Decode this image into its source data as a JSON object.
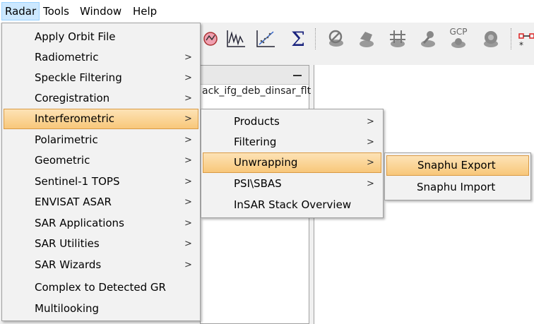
{
  "menubar": {
    "items": [
      "Radar",
      "Tools",
      "Window",
      "Help"
    ]
  },
  "toolbar": {
    "icons": [
      "graph-icon",
      "waveform-icon",
      "scatter-plot-icon",
      "sigma-icon",
      "no-orbit-icon",
      "coregistration-icon",
      "grid-icon",
      "pin-icon",
      "gcp-icon",
      "camera-icon",
      "network-icon"
    ],
    "sigma": "Σ",
    "gcp_label": "GCP"
  },
  "product_panel": {
    "item_text": "ack_ifg_deb_dinsar_flt"
  },
  "radar_menu": {
    "items": [
      {
        "label": "Apply Orbit File",
        "arrow": ""
      },
      {
        "label": "Radiometric",
        "arrow": ">"
      },
      {
        "label": "Speckle Filtering",
        "arrow": ">"
      },
      {
        "label": "Coregistration",
        "arrow": ">"
      },
      {
        "label": "Interferometric",
        "arrow": ">"
      },
      {
        "label": "Polarimetric",
        "arrow": ">"
      },
      {
        "label": "Geometric",
        "arrow": ">"
      },
      {
        "label": "Sentinel-1 TOPS",
        "arrow": ">"
      },
      {
        "label": "ENVISAT ASAR",
        "arrow": ">"
      },
      {
        "label": "SAR Applications",
        "arrow": ">"
      },
      {
        "label": "SAR Utilities",
        "arrow": ">"
      },
      {
        "label": "SAR Wizards",
        "arrow": ">"
      },
      {
        "label": "Complex to Detected GR",
        "arrow": ""
      },
      {
        "label": "Multilooking",
        "arrow": ""
      }
    ]
  },
  "interferometric_menu": {
    "items": [
      {
        "label": "Products",
        "arrow": ">"
      },
      {
        "label": "Filtering",
        "arrow": ">"
      },
      {
        "label": "Unwrapping",
        "arrow": ">"
      },
      {
        "label": "PSI\\SBAS",
        "arrow": ">"
      },
      {
        "label": "InSAR Stack Overview",
        "arrow": ""
      }
    ]
  },
  "unwrapping_menu": {
    "items": [
      {
        "label": "Snaphu Export"
      },
      {
        "label": "Snaphu Import"
      }
    ]
  }
}
